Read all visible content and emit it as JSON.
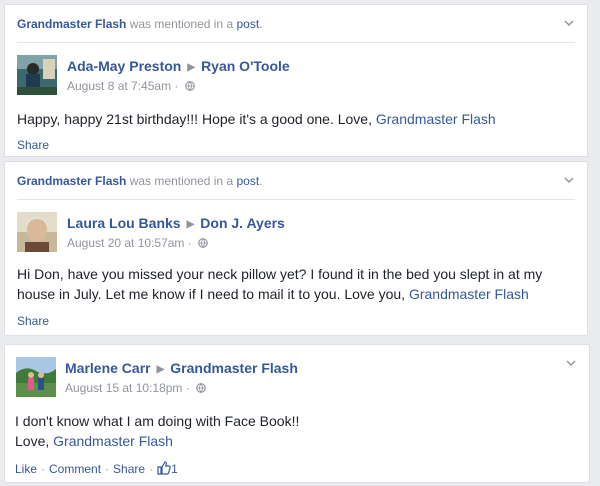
{
  "posts": [
    {
      "mention": {
        "name": "Grandmaster Flash",
        "middle": "was mentioned in a",
        "link": "post",
        "end": "."
      },
      "author": "Ada-May Preston",
      "target": "Ryan O'Toole",
      "date": "August 8 at 7:45am",
      "dot": "·",
      "text_before": "Happy, happy 21st birthday!!! Hope it's a good one. Love, ",
      "tag": "Grandmaster Flash",
      "share": "Share"
    },
    {
      "mention": {
        "name": "Grandmaster Flash",
        "middle": "was mentioned in a",
        "link": "post",
        "end": "."
      },
      "author": "Laura Lou Banks",
      "target": "Don J. Ayers",
      "date": "August 20 at 10:57am",
      "dot": "·",
      "text_before": "Hi Don, have you missed your neck pillow yet? I found it in the bed you slept in at my house in July. Let me know if I need to mail it to you. Love you, ",
      "tag": "Grandmaster Flash",
      "share": "Share"
    },
    {
      "author": "Marlene Carr",
      "target": "Grandmaster Flash",
      "date": "August 15 at 10:18pm",
      "dot": "·",
      "line1": "I don't know what I am doing with Face Book!!",
      "line2_before": "Love, ",
      "tag": "Grandmaster Flash",
      "actions": {
        "like": "Like",
        "comment": "Comment",
        "share": "Share",
        "sep": "·",
        "like_count": "1"
      }
    }
  ],
  "colors": {
    "link": "#365899",
    "muted": "#90949c",
    "background": "#e9ebee"
  }
}
